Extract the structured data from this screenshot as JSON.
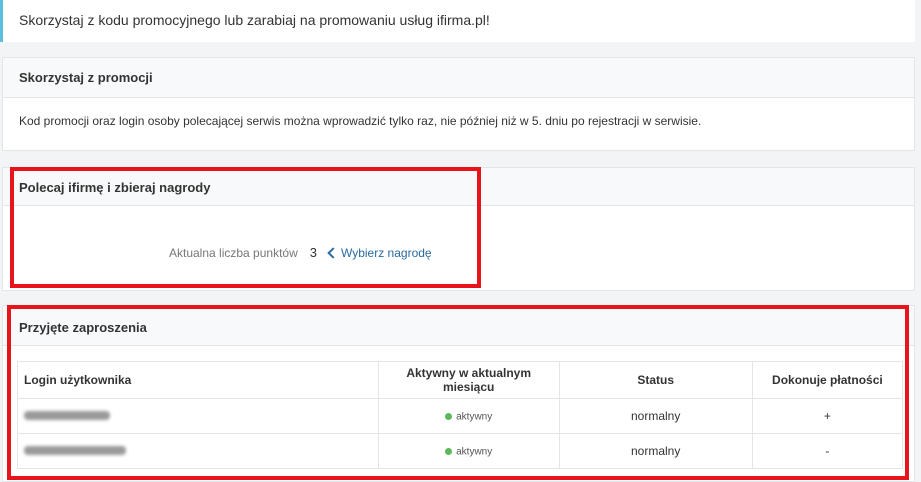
{
  "info_bar": {
    "text": "Skorzystaj z kodu promocyjnego lub zarabiaj na promowaniu usług ifirma.pl!"
  },
  "promo_panel": {
    "title": "Skorzystaj z promocji",
    "body": "Kod promocji oraz login osoby polecającej serwis można wprowadzić tylko raz, nie później niż w 5. dniu po rejestracji w serwisie."
  },
  "referral_panel": {
    "title": "Polecaj ifirmę i zbieraj nagrody",
    "points_label": "Aktualna liczba punktów",
    "points_value": "3",
    "reward_link": "Wybierz nagrodę"
  },
  "invitations_panel": {
    "title": "Przyjęte zaproszenia",
    "columns": [
      "Login użytkownika",
      "Aktywny w aktualnym miesiącu",
      "Status",
      "Dokonuje płatności"
    ],
    "rows": [
      {
        "active": "aktywny",
        "status": "normalny",
        "payments": "+"
      },
      {
        "active": "aktywny",
        "status": "normalny",
        "payments": "-"
      }
    ]
  },
  "colors": {
    "highlight": "#e8141c",
    "link": "#2b6a9e",
    "active_dot": "#5cb85c",
    "info_accent": "#5bc0de"
  }
}
